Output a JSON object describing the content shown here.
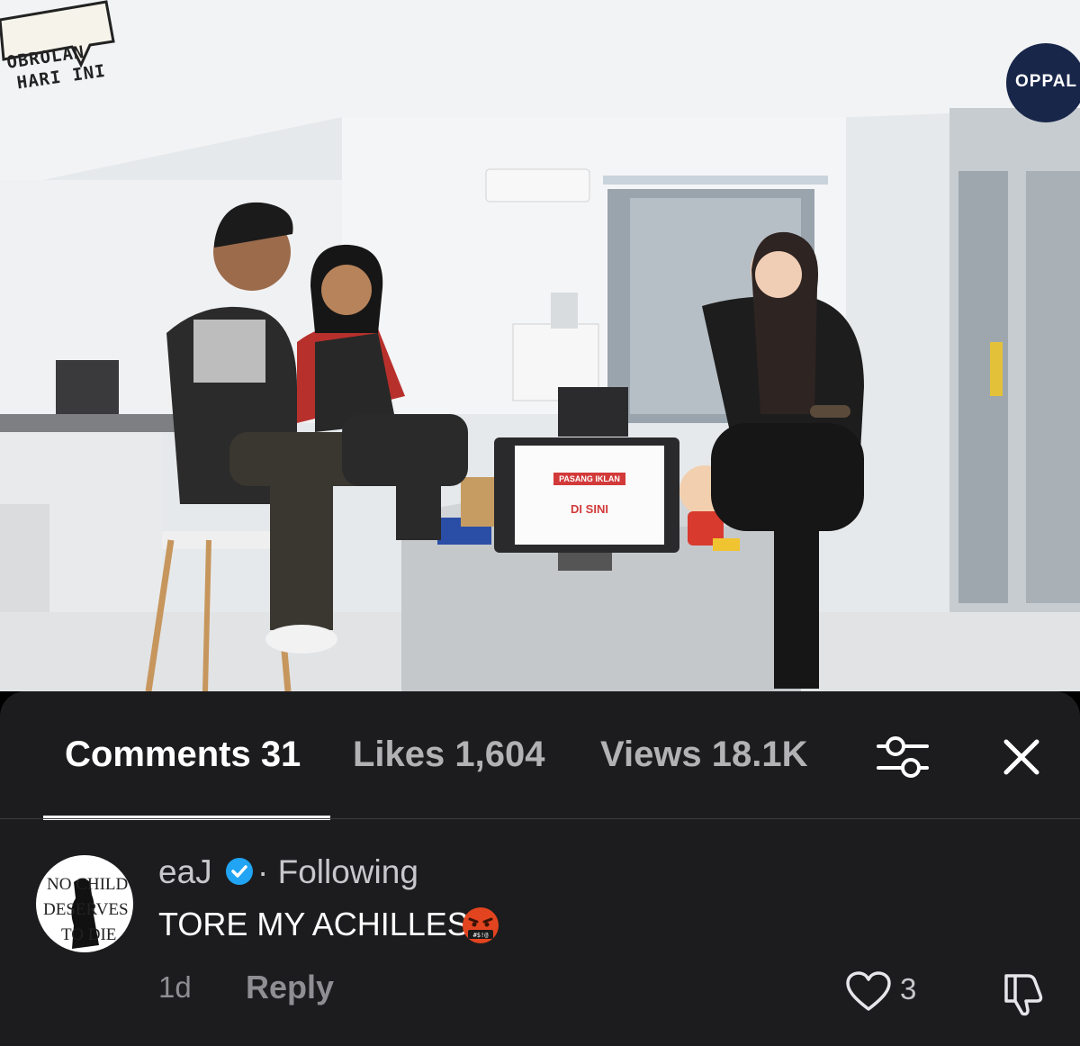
{
  "video": {
    "sticker_line1": "OBROLAN",
    "sticker_line2": "HARI INI",
    "brand_logo": "OPPAL",
    "tablet_title": "PASANG IKLAN",
    "tablet_sub": "DI SINI"
  },
  "panel": {
    "tabs": [
      {
        "label": "Comments 31",
        "active": true
      },
      {
        "label": "Likes 1,604",
        "active": false
      },
      {
        "label": "Views 18.1K",
        "active": false
      }
    ],
    "filter_icon": "sliders-icon",
    "close_icon": "close-icon"
  },
  "comment": {
    "avatar_text": [
      "NO CHILD",
      "DESERVES",
      "TO DIE"
    ],
    "username": "eaJ",
    "verified_icon": "verified-badge-icon",
    "following": "· Following",
    "text": "TORE MY ACHILLES",
    "emoji": "swearing-face-emoji",
    "time": "1d",
    "reply_label": "Reply",
    "like_count": "3",
    "heart_icon": "heart-icon",
    "dislike_icon": "thumbs-down-icon"
  }
}
